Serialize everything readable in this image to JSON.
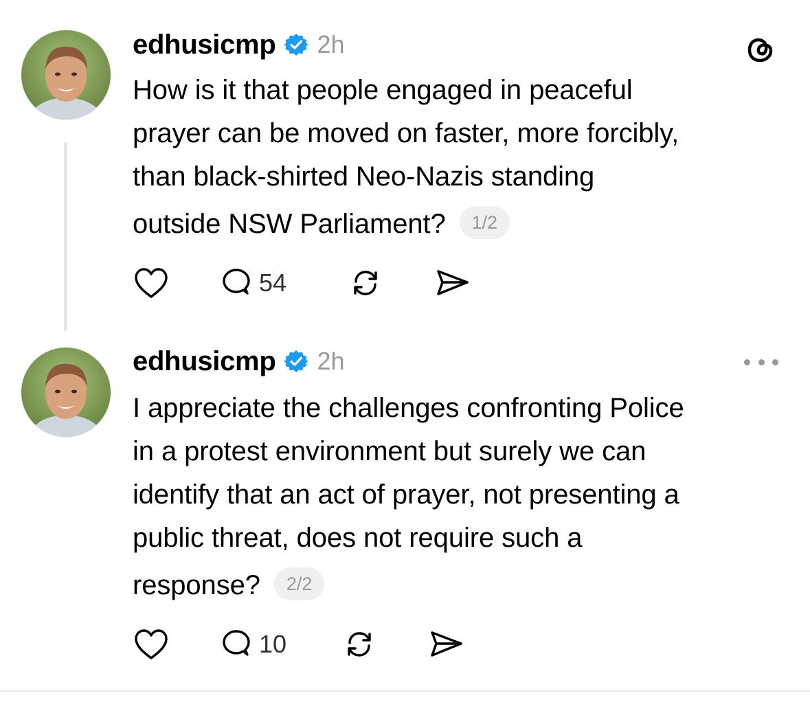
{
  "posts": [
    {
      "username": "edhusicmp",
      "time": "2h",
      "text_lines": [
        "How is it that people engaged in peaceful",
        "prayer can be moved on faster, more forcibly,",
        "than black-shirted Neo-Nazis standing",
        "outside NSW Parliament?"
      ],
      "counter": "1/2",
      "reply_count": "54",
      "top_right_icon": "threads-logo-icon"
    },
    {
      "username": "edhusicmp",
      "time": "2h",
      "text_lines": [
        "I appreciate the challenges confronting Police",
        "in a protest environment but surely we can",
        "identify that an act of prayer, not presenting a",
        "public threat, does not require such a",
        "response?"
      ],
      "counter": "2/2",
      "reply_count": "10",
      "top_right_icon": "more-options-icon"
    }
  ],
  "colors": {
    "verified": "#1d9bf0",
    "muted": "#999999",
    "text": "#000000",
    "thread_line": "#e6e6e6"
  },
  "icons": [
    "heart-icon",
    "reply-icon",
    "repost-icon",
    "share-icon",
    "verified-badge-icon"
  ]
}
